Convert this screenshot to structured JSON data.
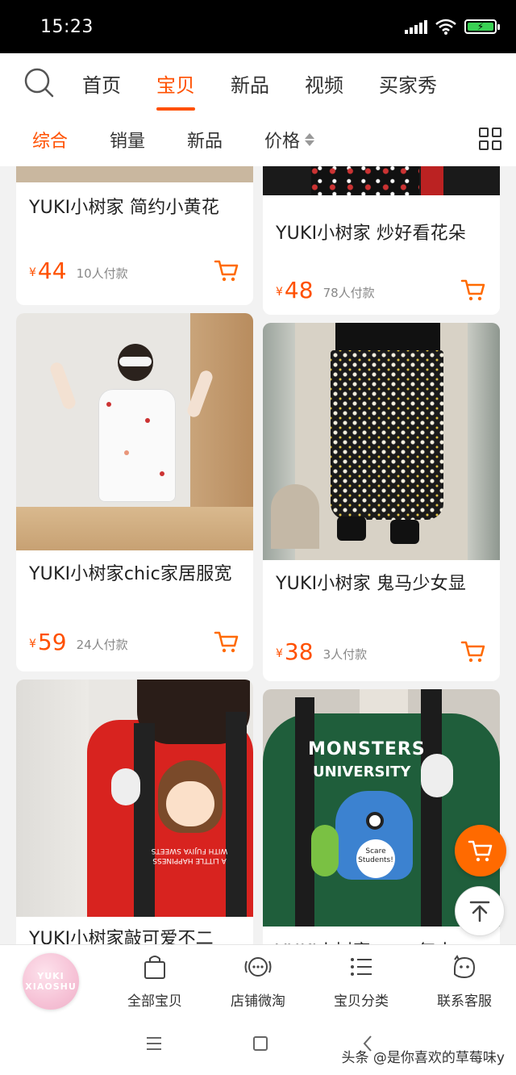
{
  "status": {
    "time": "15:23"
  },
  "topnav": {
    "tabs": [
      "首页",
      "宝贝",
      "新品",
      "视频",
      "买家秀"
    ],
    "active": "宝贝"
  },
  "sortbar": {
    "options": [
      "综合",
      "销量",
      "新品",
      "价格"
    ],
    "active": "综合"
  },
  "products": [
    {
      "title": "YUKI小树家 简约小黄花",
      "yen": "¥",
      "price": "44",
      "sold": "10人付款"
    },
    {
      "title": "YUKI小树家 炒好看花朵",
      "yen": "¥",
      "price": "48",
      "sold": "78人付款"
    },
    {
      "title": "YUKI小树家chic家居服宽",
      "yen": "¥",
      "price": "59",
      "sold": "24人付款"
    },
    {
      "title": "YUKI小树家 鬼马少女显",
      "yen": "¥",
      "price": "38",
      "sold": "3人付款"
    },
    {
      "title": "YUKI小树家敲可爱不二",
      "yen": "¥",
      "price": "",
      "sold": ""
    },
    {
      "title": "YUKI小树家 …… 复古",
      "yen": "¥",
      "price": "",
      "sold": ""
    }
  ],
  "tshirt_texts": {
    "red": "A LITTLE HAPPINESS WITH FUJIYA SWEETS",
    "green_top": "MONSTERS",
    "green_mid": "UNIVERSITY",
    "green_badge": "Scare Students!"
  },
  "shop": {
    "logo_line1": "YUKI",
    "logo_line2": "XIAOSHU",
    "items": [
      "全部宝贝",
      "店铺微淘",
      "宝贝分类",
      "联系客服"
    ]
  },
  "watermark": "头条 @是你喜欢的草莓味y",
  "colors": {
    "accent": "#ff5000",
    "fab": "#ff6a00"
  },
  "icons": [
    "search-icon",
    "sort-arrows-icon",
    "grid-toggle-icon",
    "cart-icon",
    "scroll-top-icon",
    "bag-icon",
    "feed-icon",
    "list-icon",
    "chat-face-icon"
  ]
}
